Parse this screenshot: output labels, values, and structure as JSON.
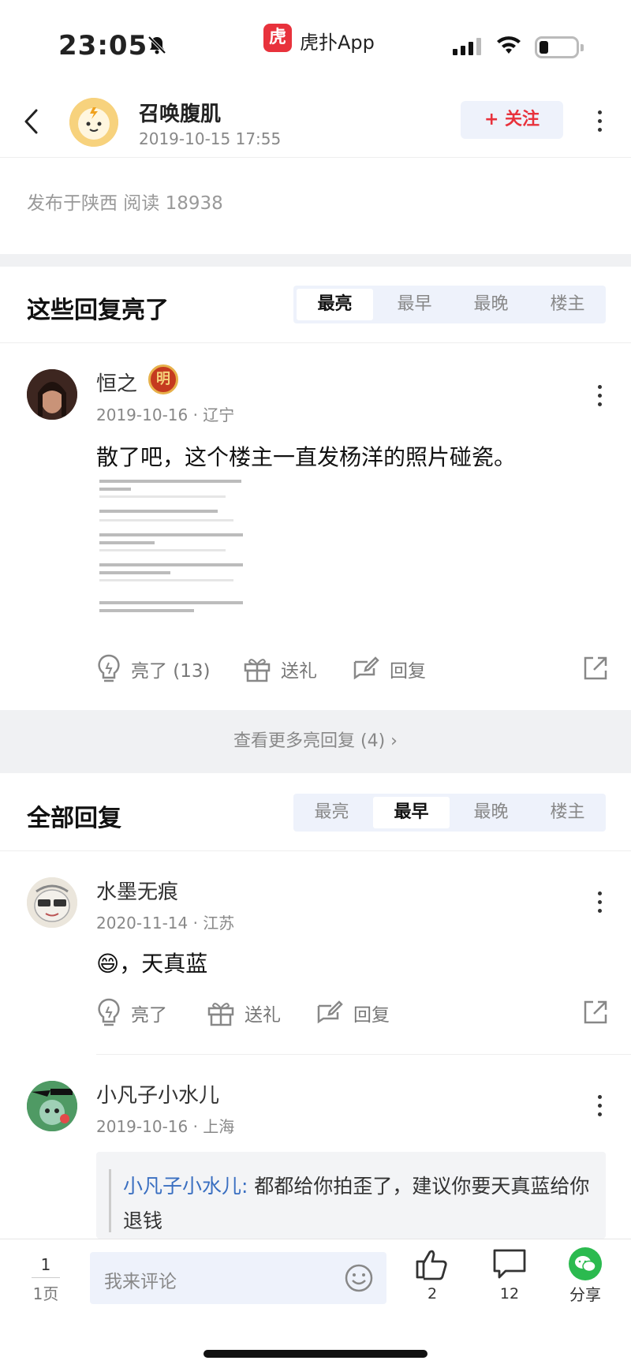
{
  "status_bar": {
    "time": "23:05",
    "app_badge": "虎",
    "app_name": "虎扑App"
  },
  "header": {
    "author_name": "召唤腹肌",
    "post_datetime": "2019-10-15 17:55",
    "follow_label": "+ 关注"
  },
  "post_meta": "发布于陕西   阅读 18938",
  "highlight_section": {
    "title": "这些回复亮了",
    "tabs": [
      "最亮",
      "最早",
      "最晚",
      "楼主"
    ],
    "active_tab": "最亮"
  },
  "highlight_reply": {
    "name": "恒之",
    "badge": "明",
    "meta": "2019-10-16 · 辽宁",
    "body": "散了吧，这个楼主一直发杨洋的照片碰瓷。",
    "actions": {
      "light": "亮了 (13)",
      "gift": "送礼",
      "reply": "回复"
    }
  },
  "more_highlights": "查看更多亮回复 (4) ›",
  "all_section": {
    "title": "全部回复",
    "tabs": [
      "最亮",
      "最早",
      "最晚",
      "楼主"
    ],
    "active_tab": "最早"
  },
  "replies": [
    {
      "name": "水墨无痕",
      "meta": "2020-11-14 · 江苏",
      "body": "😄，天真蓝",
      "actions": {
        "light": "亮了",
        "gift": "送礼",
        "reply": "回复"
      }
    },
    {
      "name": "小凡子小水儿",
      "meta": "2019-10-16 · 上海",
      "quote_name": "小凡子小水儿:",
      "quote_text": " 都都给你拍歪了，建议你要天真蓝给你退钱"
    }
  ],
  "bottom_bar": {
    "page_current": "1",
    "page_total": "1页",
    "comment_placeholder": "我来评论",
    "likes": "2",
    "comments": "12",
    "share": "分享"
  },
  "colors": {
    "accent_red": "#e8323c",
    "link_blue": "#3a6fc1",
    "tab_bg": "#eef2fb",
    "wechat_green": "#2bba4f"
  }
}
